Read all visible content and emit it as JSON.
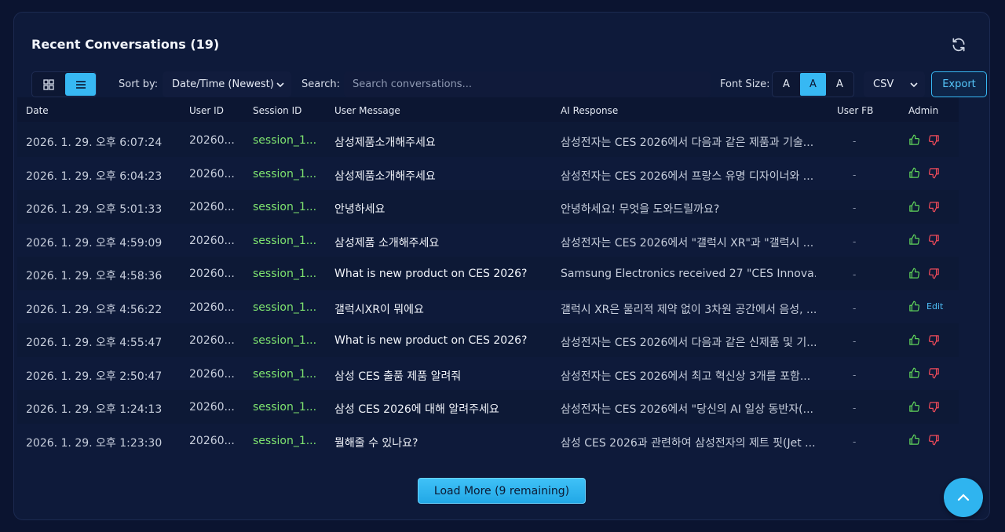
{
  "panel": {
    "title": "Recent Conversations (19)"
  },
  "toolbar": {
    "sort_label": "Sort by:",
    "sort_value": "Date/Time (Newest)",
    "search_label": "Search:",
    "search_placeholder": "Search conversations...",
    "font_size_label": "Font Size:",
    "font_buttons": [
      "A",
      "A",
      "A"
    ],
    "active_font_index": 1,
    "export_format": "CSV",
    "export_label": "Export"
  },
  "table": {
    "headers": {
      "date": "Date",
      "user_id": "User ID",
      "session_id": "Session ID",
      "user_message": "User Message",
      "ai_response": "AI Response",
      "user_fb": "User FB",
      "admin": "Admin"
    },
    "rows": [
      {
        "date": "2026. 1. 29. 오후 6:07:24",
        "user_id": "20260...",
        "session_id": "session_1...",
        "user_message": "삼성제품소개해주세요",
        "ai_response": "삼성전자는 CES 2026에서 다음과 같은 제품과 기술...",
        "user_fb": "-",
        "admin": "thumbs"
      },
      {
        "date": "2026. 1. 29. 오후 6:04:23",
        "user_id": "20260...",
        "session_id": "session_1...",
        "user_message": "삼성제품소개해주세요",
        "ai_response": "삼성전자는 CES 2026에서 프랑스 유명 디자이너와 ...",
        "user_fb": "-",
        "admin": "thumbs"
      },
      {
        "date": "2026. 1. 29. 오후 5:01:33",
        "user_id": "20260...",
        "session_id": "session_1...",
        "user_message": "안녕하세요",
        "ai_response": "안녕하세요! 무엇을 도와드릴까요?",
        "user_fb": "-",
        "admin": "thumbs"
      },
      {
        "date": "2026. 1. 29. 오후 4:59:09",
        "user_id": "20260...",
        "session_id": "session_1...",
        "user_message": "삼성제품 소개해주세요",
        "ai_response": "삼성전자는 CES 2026에서 \"갤럭시 XR\"과 \"갤럭시 ...",
        "user_fb": "-",
        "admin": "thumbs"
      },
      {
        "date": "2026. 1. 29. 오후 4:58:36",
        "user_id": "20260...",
        "session_id": "session_1...",
        "user_message": "What is new product on CES 2026?",
        "ai_response": "Samsung Electronics received 27 \"CES Innova...",
        "user_fb": "-",
        "admin": "thumbs"
      },
      {
        "date": "2026. 1. 29. 오후 4:56:22",
        "user_id": "20260...",
        "session_id": "session_1...",
        "user_message": "갤럭시XR이 뭐에요",
        "ai_response": "갤럭시 XR은 물리적 제약 없이 3차원 공간에서 음성, ...",
        "user_fb": "-",
        "admin": "edit",
        "edit_label": "Edit"
      },
      {
        "date": "2026. 1. 29. 오후 4:55:47",
        "user_id": "20260...",
        "session_id": "session_1...",
        "user_message": "What is new product on CES 2026?",
        "ai_response": "삼성전자는 CES 2026에서 다음과 같은 신제품 및 기...",
        "user_fb": "-",
        "admin": "thumbs"
      },
      {
        "date": "2026. 1. 29. 오후 2:50:47",
        "user_id": "20260...",
        "session_id": "session_1...",
        "user_message": "삼성 CES 출품 제품 알려줘",
        "ai_response": "삼성전자는 CES 2026에서 최고 혁신상 3개를 포함...",
        "user_fb": "-",
        "admin": "thumbs"
      },
      {
        "date": "2026. 1. 29. 오후 1:24:13",
        "user_id": "20260...",
        "session_id": "session_1...",
        "user_message": "삼성 CES 2026에 대해 알려주세요",
        "ai_response": "삼성전자는 CES 2026에서 \"당신의 AI 일상 동반자(...",
        "user_fb": "-",
        "admin": "thumbs"
      },
      {
        "date": "2026. 1. 29. 오후 1:23:30",
        "user_id": "20260...",
        "session_id": "session_1...",
        "user_message": "뭘해줄 수 있나요?",
        "ai_response": "삼성 CES 2026과 관련하여 삼성전자의 제트 핏(Jet ...",
        "user_fb": "-",
        "admin": "thumbs"
      }
    ]
  },
  "load_more": {
    "label": "Load More (9 remaining)"
  },
  "icons": {
    "refresh": "refresh-icon",
    "grid_view": "grid-view-icon",
    "list_view": "list-view-icon",
    "chevron": "chevron-down-icon",
    "thumbs_up": "thumbs-up-icon",
    "thumbs_down": "thumbs-down-icon",
    "scroll_top": "chevron-up-icon"
  },
  "colors": {
    "accent": "#37b8f3",
    "session_green": "#7ee36f",
    "thumbs_up": "#5fd35a",
    "thumbs_down": "#f04b5a"
  }
}
